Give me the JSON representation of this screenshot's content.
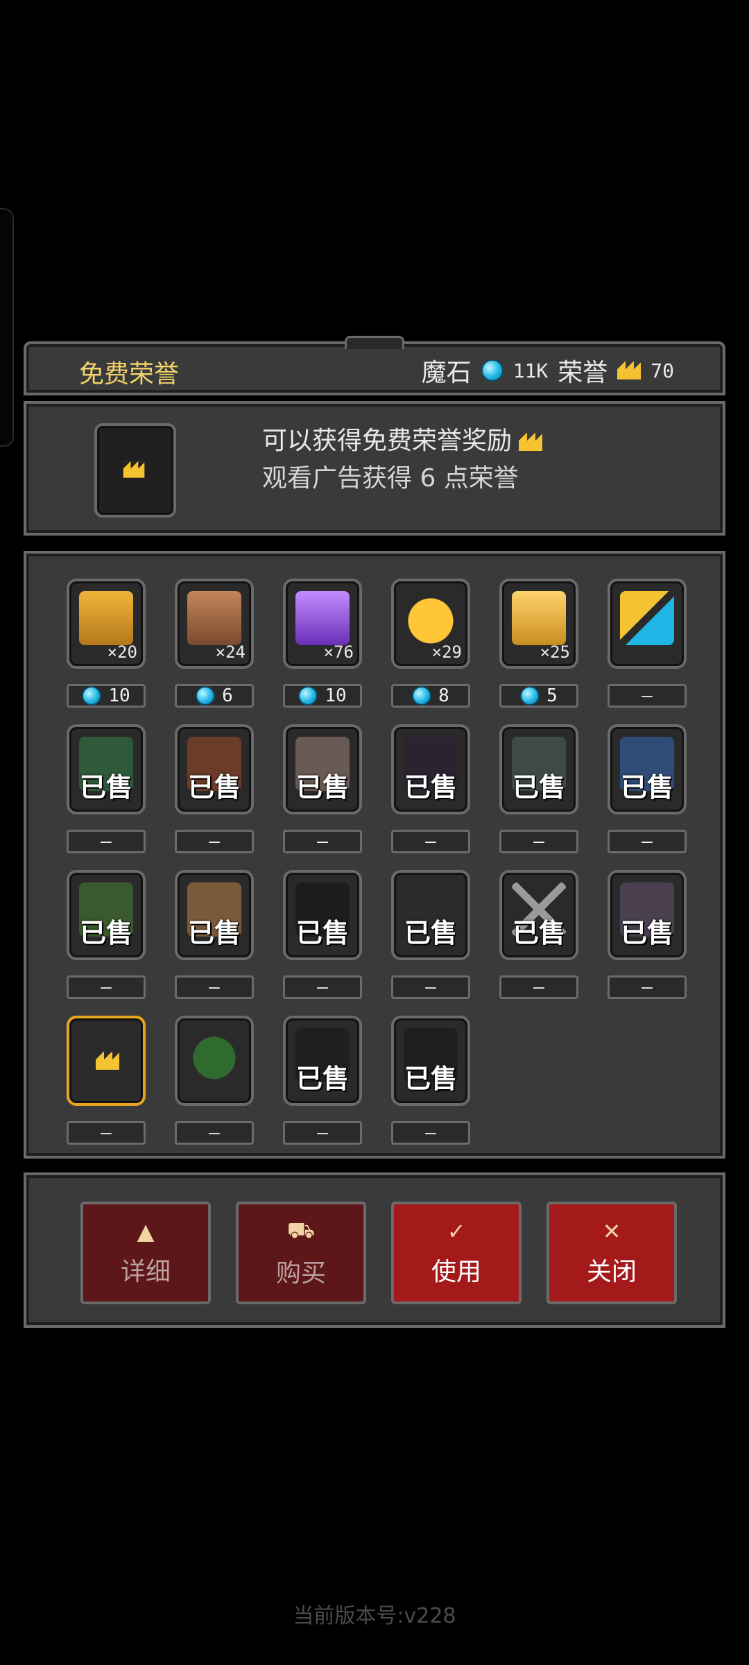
{
  "header": {
    "title": "免费荣誉",
    "currency1_label": "魔石",
    "currency1_value": "11K",
    "currency2_label": "荣誉",
    "currency2_value": "70"
  },
  "reward": {
    "line1": "可以获得免费荣誉奖励",
    "line2": "观看广告获得 6 点荣誉"
  },
  "items": {
    "row1": [
      {
        "qty": "×20",
        "price": "10"
      },
      {
        "qty": "×24",
        "price": "6"
      },
      {
        "qty": "×76",
        "price": "10"
      },
      {
        "qty": "×29",
        "price": "8"
      },
      {
        "qty": "×25",
        "price": "5"
      },
      {
        "qty": "",
        "price": "—"
      }
    ],
    "row2": [
      {
        "sold": "已售",
        "price": "—"
      },
      {
        "sold": "已售",
        "price": "—"
      },
      {
        "sold": "已售",
        "price": "—"
      },
      {
        "sold": "已售",
        "price": "—"
      },
      {
        "sold": "已售",
        "price": "—"
      },
      {
        "sold": "已售",
        "price": "—"
      }
    ],
    "row3": [
      {
        "sold": "已售",
        "price": "—"
      },
      {
        "sold": "已售",
        "price": "—"
      },
      {
        "sold": "已售",
        "price": "—"
      },
      {
        "sold": "已售",
        "price": "—"
      },
      {
        "sold": "已售",
        "price": "—"
      },
      {
        "sold": "已售",
        "price": "—"
      }
    ],
    "row4": [
      {
        "sold": "",
        "price": "—"
      },
      {
        "sold": "",
        "price": "—"
      },
      {
        "sold": "已售",
        "price": "—"
      },
      {
        "sold": "已售",
        "price": "—"
      }
    ]
  },
  "actions": {
    "details": "详细",
    "buy": "购买",
    "use": "使用",
    "close": "关闭"
  },
  "footer": {
    "version": "当前版本号:v228"
  },
  "colors": {
    "accent_gold": "#f3d36b",
    "gem_blue": "#1fb6e6",
    "button_red": "#a41a1b"
  }
}
